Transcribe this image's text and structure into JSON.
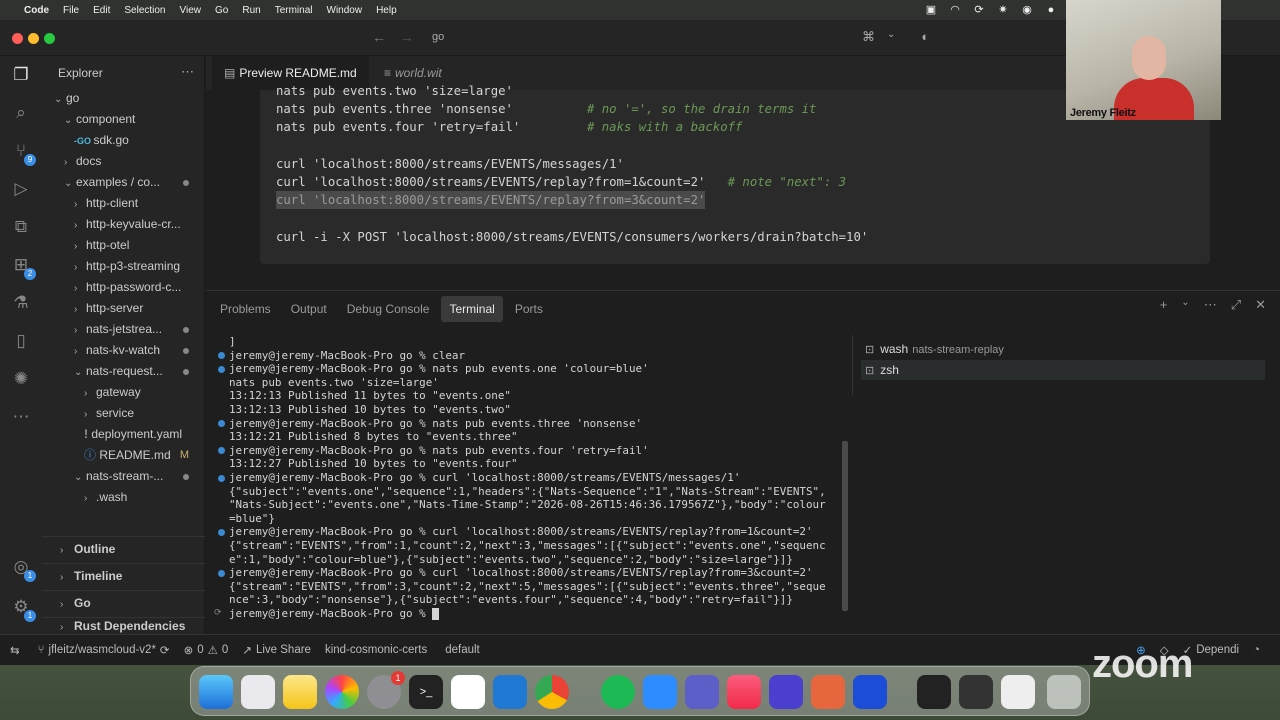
{
  "menubar": {
    "app": "Code",
    "items": [
      "File",
      "Edit",
      "Selection",
      "View",
      "Go",
      "Run",
      "Terminal",
      "Window",
      "Help"
    ]
  },
  "titlebar": {
    "search": "go"
  },
  "explorer": {
    "title": "Explorer",
    "items": [
      {
        "label": "go",
        "indent": 0,
        "chev": "⌄"
      },
      {
        "label": "component",
        "indent": 1,
        "chev": "⌄"
      },
      {
        "label": "sdk.go",
        "indent": 2,
        "icon": "GO"
      },
      {
        "label": "docs",
        "indent": 1,
        "chev": "›"
      },
      {
        "label": "examples / co...",
        "indent": 1,
        "chev": "⌄"
      },
      {
        "label": "http-client",
        "indent": 2,
        "chev": "›"
      },
      {
        "label": "http-keyvalue-cr...",
        "indent": 2,
        "chev": "›"
      },
      {
        "label": "http-otel",
        "indent": 2,
        "chev": "›"
      },
      {
        "label": "http-p3-streaming",
        "indent": 2,
        "chev": "›"
      },
      {
        "label": "http-password-c...",
        "indent": 2,
        "chev": "›"
      },
      {
        "label": "http-server",
        "indent": 2,
        "chev": "›"
      },
      {
        "label": "nats-jetstrea...",
        "indent": 2,
        "chev": "›"
      },
      {
        "label": "nats-kv-watch",
        "indent": 2,
        "chev": "›"
      },
      {
        "label": "nats-request...",
        "indent": 2,
        "chev": "⌄"
      },
      {
        "label": "gateway",
        "indent": 3,
        "chev": "›"
      },
      {
        "label": "service",
        "indent": 3,
        "chev": "›"
      },
      {
        "label": "deployment.yaml",
        "indent": 3,
        "icon": "!"
      },
      {
        "label": "README.md",
        "indent": 3,
        "icon": "i",
        "flag": "M"
      },
      {
        "label": "nats-stream-...",
        "indent": 2,
        "chev": "⌄"
      },
      {
        "label": ".wash",
        "indent": 3,
        "chev": "›"
      }
    ],
    "sections": [
      "Outline",
      "Timeline",
      "Go",
      "Rust Dependencies"
    ]
  },
  "tabs": {
    "active": "Preview README.md",
    "inactive": "world.wit"
  },
  "code": [
    {
      "text": "nats pub events.two 'size=large'",
      "comment": ""
    },
    {
      "text": "nats pub events.three 'nonsense'          ",
      "comment": "# no '=', so the drain terms it"
    },
    {
      "text": "nats pub events.four 'retry=fail'         ",
      "comment": "# naks with a backoff"
    },
    {
      "text": "",
      "comment": ""
    },
    {
      "text": "curl 'localhost:8000/streams/EVENTS/messages/1'",
      "comment": ""
    },
    {
      "text": "curl 'localhost:8000/streams/EVENTS/replay?from=1&count=2'   ",
      "comment": "# note \"next\": 3"
    },
    {
      "text": "curl 'localhost:8000/streams/EVENTS/replay?from=3&count=2'",
      "comment": "",
      "highlight": true
    },
    {
      "text": "",
      "comment": ""
    },
    {
      "text": "curl -i -X POST 'localhost:8000/streams/EVENTS/consumers/workers/drain?batch=10'",
      "comment": ""
    }
  ],
  "panel": {
    "tabs": [
      "Problems",
      "Output",
      "Debug Console",
      "Terminal",
      "Ports"
    ],
    "active_tab": "Terminal"
  },
  "terminal": {
    "lines": [
      {
        "t": "]",
        "dot": false
      },
      {
        "t": "jeremy@jeremy-MacBook-Pro go % clear",
        "dot": true
      },
      {
        "t": "jeremy@jeremy-MacBook-Pro go % nats pub events.one 'colour=blue'",
        "dot": true
      },
      {
        "t": "nats pub events.two 'size=large'",
        "dot": false
      },
      {
        "t": "13:12:13 Published 11 bytes to \"events.one\"",
        "dot": false
      },
      {
        "t": "13:12:13 Published 10 bytes to \"events.two\"",
        "dot": false
      },
      {
        "t": "jeremy@jeremy-MacBook-Pro go % nats pub events.three 'nonsense'",
        "dot": true
      },
      {
        "t": "13:12:21 Published 8 bytes to \"events.three\"",
        "dot": false
      },
      {
        "t": "jeremy@jeremy-MacBook-Pro go % nats pub events.four 'retry=fail'",
        "dot": true
      },
      {
        "t": "13:12:27 Published 10 bytes to \"events.four\"",
        "dot": false
      },
      {
        "t": "jeremy@jeremy-MacBook-Pro go % curl 'localhost:8000/streams/EVENTS/messages/1'",
        "dot": true
      },
      {
        "t": "{\"subject\":\"events.one\",\"sequence\":1,\"headers\":{\"Nats-Sequence\":\"1\",\"Nats-Stream\":\"EVENTS\",",
        "dot": false
      },
      {
        "t": "\"Nats-Subject\":\"events.one\",\"Nats-Time-Stamp\":\"2026-08-26T15:46:36.179567Z\"},\"body\":\"colour",
        "dot": false
      },
      {
        "t": "=blue\"}",
        "dot": false
      },
      {
        "t": "jeremy@jeremy-MacBook-Pro go % curl 'localhost:8000/streams/EVENTS/replay?from=1&count=2'",
        "dot": true
      },
      {
        "t": "{\"stream\":\"EVENTS\",\"from\":1,\"count\":2,\"next\":3,\"messages\":[{\"subject\":\"events.one\",\"sequenc",
        "dot": false
      },
      {
        "t": "e\":1,\"body\":\"colour=blue\"},{\"subject\":\"events.two\",\"sequence\":2,\"body\":\"size=large\"}]}",
        "dot": false
      },
      {
        "t": "jeremy@jeremy-MacBook-Pro go % curl 'localhost:8000/streams/EVENTS/replay?from=3&count=2'",
        "dot": true
      },
      {
        "t": "{\"stream\":\"EVENTS\",\"from\":3,\"count\":2,\"next\":5,\"messages\":[{\"subject\":\"events.three\",\"seque",
        "dot": false
      },
      {
        "t": "nce\":3,\"body\":\"nonsense\"},{\"subject\":\"events.four\",\"sequence\":4,\"body\":\"retry=fail\"}]}",
        "dot": false
      }
    ],
    "prompt": "jeremy@jeremy-MacBook-Pro go % "
  },
  "terminal_list": [
    {
      "name": "wash",
      "sub": "nats-stream-replay"
    },
    {
      "name": "zsh",
      "sub": ""
    }
  ],
  "statusbar": {
    "branch": "jfleitz/wasmcloud-v2*",
    "errors": "0",
    "warnings": "0",
    "live_share": "Live Share",
    "context": "kind-cosmonic-certs",
    "namespace": "default",
    "deps": "Dependi"
  },
  "webcam": {
    "name": "Jeremy Fleitz"
  },
  "dock": {
    "messages_badge": "1"
  },
  "watermark": "zoom"
}
